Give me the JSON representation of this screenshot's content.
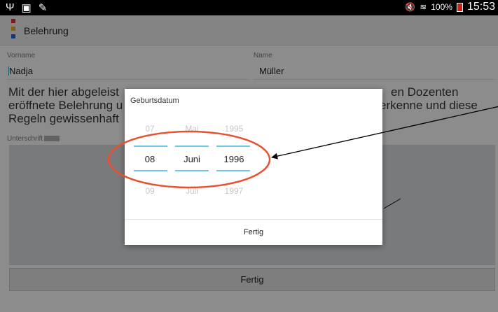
{
  "status_bar": {
    "percent": "100%",
    "time": "15:53"
  },
  "app": {
    "title": "Belehrung"
  },
  "form": {
    "vorname_label": "Vorname",
    "vorname_value": "Nadja",
    "name_label": "Name",
    "name_value": "Müller",
    "intro_line1_left": "Mit der hier abgeleist",
    "intro_line1_right": "en Dozenten",
    "intro_line2_left": "eröffnete Belehrung u",
    "intro_line2_right": "erkenne und diese",
    "intro_line3_left": "Regeln gewissenhaft",
    "signature_label": "Unterschrift",
    "bottom_button": "Fertig"
  },
  "dialog": {
    "title": "Geburtsdatum",
    "day": {
      "prev": "07",
      "selected": "08",
      "next": "09"
    },
    "month": {
      "prev": "Mai",
      "selected": "Juni",
      "next": "Juli"
    },
    "year": {
      "prev": "1995",
      "selected": "1996",
      "next": "1997"
    },
    "done_button": "Fertig"
  },
  "colors": {
    "annotation_ellipse": "#e8502e",
    "picker_line": "#6ec6e6",
    "logo": [
      "#e02a2a",
      "#e7a21b",
      "#2a5bd7"
    ]
  }
}
